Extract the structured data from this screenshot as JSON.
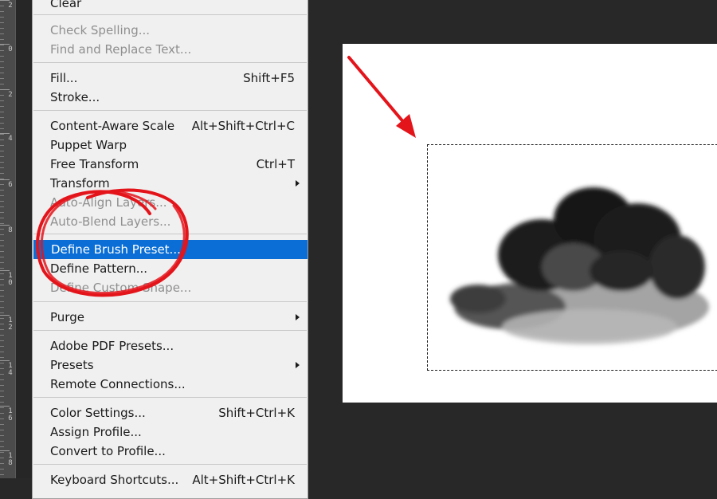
{
  "ruler": {
    "labels": [
      "2",
      "0",
      "2",
      "4",
      "6",
      "8",
      "1\n0",
      "1\n2",
      "1\n4",
      "1\n6",
      "1\n8"
    ]
  },
  "menu": {
    "items": [
      {
        "label": "Clear",
        "shortcut": "",
        "disabled": false
      },
      {
        "label": "Check Spelling...",
        "shortcut": "",
        "disabled": true
      },
      {
        "label": "Find and Replace Text...",
        "shortcut": "",
        "disabled": true
      },
      {
        "label": "Fill...",
        "shortcut": "Shift+F5",
        "disabled": false
      },
      {
        "label": "Stroke...",
        "shortcut": "",
        "disabled": false
      },
      {
        "label": "Content-Aware Scale",
        "shortcut": "Alt+Shift+Ctrl+C",
        "disabled": false
      },
      {
        "label": "Puppet Warp",
        "shortcut": "",
        "disabled": false
      },
      {
        "label": "Free Transform",
        "shortcut": "Ctrl+T",
        "disabled": false
      },
      {
        "label": "Transform",
        "shortcut": "",
        "disabled": false,
        "submenu": true
      },
      {
        "label": "Auto-Align Layers...",
        "shortcut": "",
        "disabled": true
      },
      {
        "label": "Auto-Blend Layers...",
        "shortcut": "",
        "disabled": true
      },
      {
        "label": "Define Brush Preset...",
        "shortcut": "",
        "disabled": false,
        "selected": true
      },
      {
        "label": "Define Pattern...",
        "shortcut": "",
        "disabled": false
      },
      {
        "label": "Define Custom Shape...",
        "shortcut": "",
        "disabled": true
      },
      {
        "label": "Purge",
        "shortcut": "",
        "disabled": false,
        "submenu": true
      },
      {
        "label": "Adobe PDF Presets...",
        "shortcut": "",
        "disabled": false
      },
      {
        "label": "Presets",
        "shortcut": "",
        "disabled": false,
        "submenu": true
      },
      {
        "label": "Remote Connections...",
        "shortcut": "",
        "disabled": false
      },
      {
        "label": "Color Settings...",
        "shortcut": "Shift+Ctrl+K",
        "disabled": false
      },
      {
        "label": "Assign Profile...",
        "shortcut": "",
        "disabled": false
      },
      {
        "label": "Convert to Profile...",
        "shortcut": "",
        "disabled": false
      },
      {
        "label": "Keyboard Shortcuts...",
        "shortcut": "Alt+Shift+Ctrl+K",
        "disabled": false
      }
    ]
  },
  "colors": {
    "selection": "#0a6ed6",
    "annotation": "#e4141b",
    "workspace": "#282828"
  },
  "annotations": {
    "circle_icon": "red-circle-highlight",
    "arrow_icon": "red-arrow-pointer"
  }
}
